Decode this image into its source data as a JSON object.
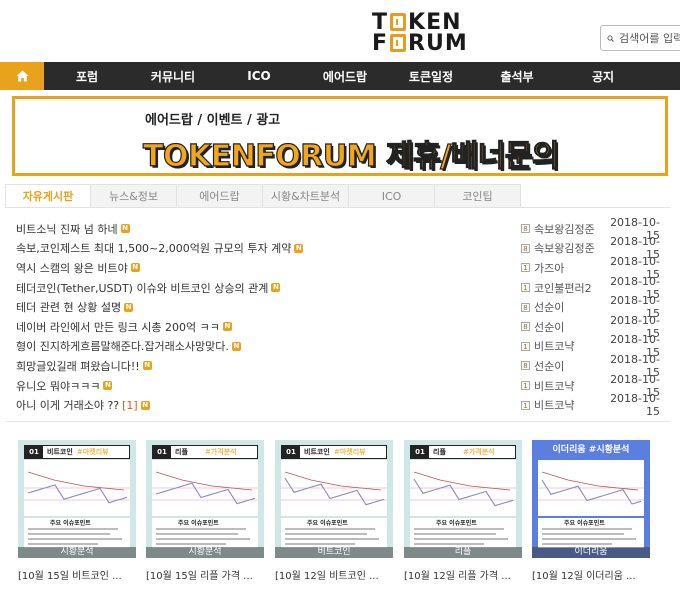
{
  "header": {
    "logo_line1": [
      "T",
      "KEN"
    ],
    "logo_line2": [
      "F",
      "RUM"
    ],
    "search_placeholder": "검색어를 입력"
  },
  "nav": {
    "home_icon": "home-icon",
    "items": [
      "포럼",
      "커뮤니티",
      "ICO",
      "에어드랍",
      "토큰일정",
      "출석부",
      "공지"
    ]
  },
  "banner": {
    "sub": "에어드랍 / 이벤트 / 광고",
    "main": "TOKENFORUM 제휴/배너문의"
  },
  "tabs": [
    "자유게시판",
    "뉴스&정보",
    "에어드랍",
    "시황&차트분석",
    "ICO",
    "코인팁"
  ],
  "posts": [
    {
      "title": "비트소닉 진짜 넘 하네",
      "comments": "",
      "level": "8",
      "author": "속보왕김정준",
      "date": "2018-10-15"
    },
    {
      "title": "속보,코인제스트 최대 1,500~2,000억원 규모의 투자 계약",
      "comments": "",
      "level": "8",
      "author": "속보왕김정준",
      "date": "2018-10-15"
    },
    {
      "title": "역시 스캠의 왕은 비트야",
      "comments": "",
      "level": "1",
      "author": "가즈아",
      "date": "2018-10-15"
    },
    {
      "title": "테더코인(Tether,USDT) 이슈와 비트코인 상승의 관계",
      "comments": "",
      "level": "1",
      "author": "코인불편러2",
      "date": "2018-10-15"
    },
    {
      "title": "테더 관련 현 상황 설명",
      "comments": "",
      "level": "8",
      "author": "선순이",
      "date": "2018-10-15"
    },
    {
      "title": "네이버 라인에서 만든 링크 시총 200억 ㅋㅋ",
      "comments": "",
      "level": "8",
      "author": "선순이",
      "date": "2018-10-15"
    },
    {
      "title": "형이 진지하게흐름말해준다.잡거래소사망맞다.",
      "comments": "",
      "level": "1",
      "author": "비트코냑",
      "date": "2018-10-15"
    },
    {
      "title": "희망글있길래 펴왔습니다!!",
      "comments": "",
      "level": "8",
      "author": "선순이",
      "date": "2018-10-15"
    },
    {
      "title": "유니오 뭐야ㅋㅋㅋ",
      "comments": "",
      "level": "1",
      "author": "비트코냑",
      "date": "2018-10-15"
    },
    {
      "title": "아니 이게 거래소야 ??",
      "comments": "[1]",
      "level": "1",
      "author": "비트코냑",
      "date": "2018-10-15"
    }
  ],
  "new_badge": "N",
  "gallery": [
    {
      "num": "01",
      "tag": "비트코인",
      "hash": "#마켓리뷰",
      "info": "주요 이슈포인트",
      "caption": "시황분석",
      "title": "[10월 15일 비트코인 ..."
    },
    {
      "num": "01",
      "tag": "리플",
      "hash": "#가격분석",
      "info": "주요 이슈포인트",
      "caption": "시황분석",
      "title": "[10월 15일 리플 가격 ..."
    },
    {
      "num": "01",
      "tag": "비트코인",
      "hash": "#마켓리뷰",
      "info": "주요 이슈포인트",
      "caption": "비트코인",
      "title": "[10월 12일 비트코인 ..."
    },
    {
      "num": "01",
      "tag": "리플",
      "hash": "#가격분석",
      "info": "주요 이슈포인트",
      "caption": "리플",
      "title": "[10월 12일 리플 가격 ..."
    },
    {
      "num": "",
      "tag": "이더리움 #시황분석",
      "hash": "",
      "info": "주요 이슈포인트",
      "caption": "이더리움",
      "title": "[10월 12일 이더리움 ..."
    }
  ],
  "colors": {
    "accent": "#e8a21c",
    "nav_bg": "#2b2b2b",
    "thumb_bg": "#cfe7e6",
    "thumb_blue": "#5a7fe0"
  }
}
